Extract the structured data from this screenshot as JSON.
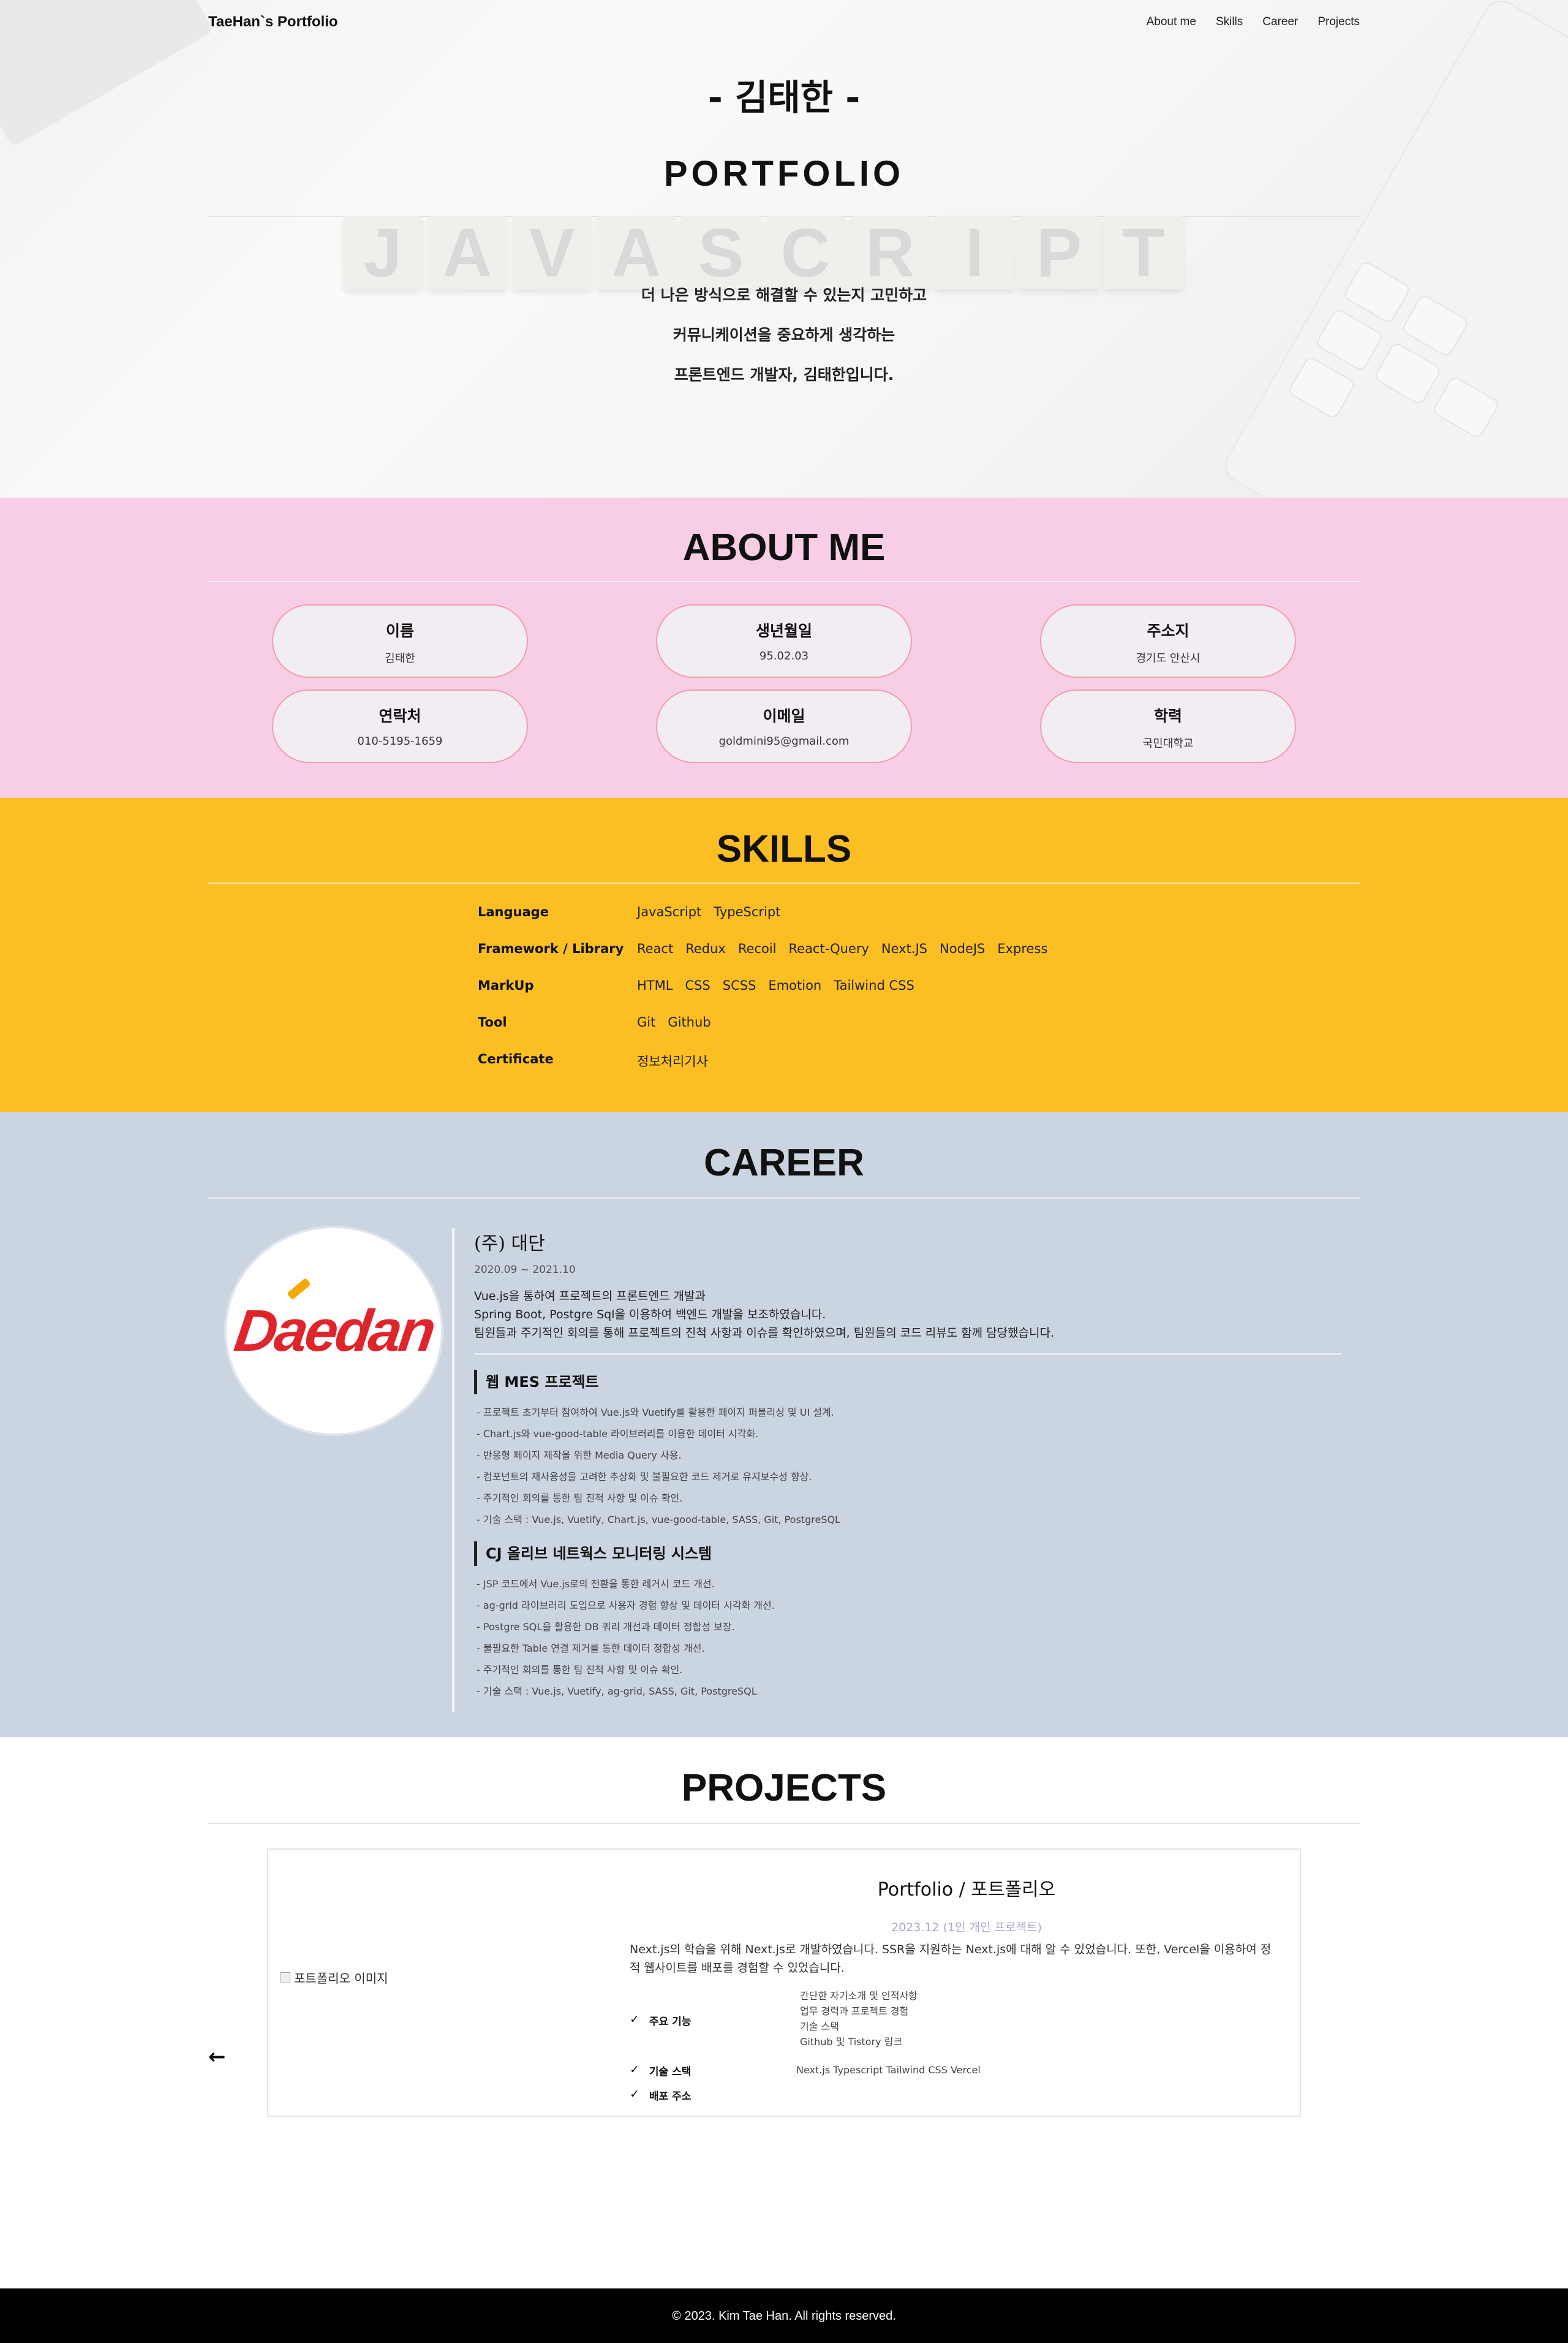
{
  "nav": {
    "brand": "TaeHan`s Portfolio",
    "links": [
      "About me",
      "Skills",
      "Career",
      "Projects"
    ]
  },
  "hero": {
    "name": "- 김태한 -",
    "title": "PORTFOLIO",
    "tiles": [
      "J",
      "A",
      "V",
      "A",
      "S",
      "C",
      "R",
      "I",
      "P",
      "T"
    ],
    "tagline": [
      "더 나은 방식으로 해결할 수 있는지 고민하고",
      "커뮤니케이션을 중요하게 생각하는",
      "프론트엔드 개발자, 김태한입니다."
    ]
  },
  "about": {
    "title": "ABOUT ME",
    "cards": [
      {
        "label": "이름",
        "value": "김태한"
      },
      {
        "label": "생년월일",
        "value": "95.02.03"
      },
      {
        "label": "주소지",
        "value": "경기도 안산시"
      },
      {
        "label": "연락처",
        "value": "010-5195-1659"
      },
      {
        "label": "이메일",
        "value": "goldmini95@gmail.com"
      },
      {
        "label": "학력",
        "value": "국민대학교"
      }
    ]
  },
  "skills": {
    "title": "SKILLS",
    "rows": [
      {
        "category": "Language",
        "items": [
          "JavaScript",
          "TypeScript"
        ]
      },
      {
        "category": "Framework / Library",
        "items": [
          "React",
          "Redux",
          "Recoil",
          "React-Query",
          "Next.JS",
          "NodeJS",
          "Express"
        ]
      },
      {
        "category": "MarkUp",
        "items": [
          "HTML",
          "CSS",
          "SCSS",
          "Emotion",
          "Tailwind CSS"
        ]
      },
      {
        "category": "Tool",
        "items": [
          "Git",
          "Github"
        ]
      },
      {
        "category": "Certificate",
        "items": [
          "정보처리기사"
        ]
      }
    ]
  },
  "career": {
    "title": "CAREER",
    "logo_text": "Daedan",
    "company": "(주) 대단",
    "period": "2020.09 ~ 2021.10",
    "desc": [
      "Vue.js을 통하여 프로젝트의 프론트엔드 개발과",
      "Spring Boot, Postgre Sql을 이용하여 백엔드 개발을 보조하였습니다.",
      "팀원들과 주기적인 회의를 통해 프로젝트의 진척 사항과 이슈를 확인하였으며, 팀원들의 코드 리뷰도 함께 담당했습니다."
    ],
    "projects": [
      {
        "name": "웹 MES 프로젝트",
        "bullets": [
          "- 프로젝트 초기부터 참여하여 Vue.js와 Vuetify를 활용한 페이지 퍼블리싱 및 UI 설계.",
          "- Chart.js와 vue-good-table 라이브러리를 이용한 데이터 시각화.",
          "- 반응형 페이지 제작을 위한 Media Query 사용.",
          "- 컴포넌트의 재사용성을 고려한 추상화 및 불필요한 코드 제거로 유지보수성 향상.",
          "- 주기적인 회의를 통한 팀 진척 사항 및 이슈 확인.",
          "- 기술 스택 : Vue.js, Vuetify, Chart.js, vue-good-table, SASS, Git, PostgreSQL"
        ]
      },
      {
        "name": "CJ 올리브 네트웍스 모니터링 시스템",
        "bullets": [
          "- JSP 코드에서 Vue.js로의 전환을 통한 레거시 코드 개선.",
          "- ag-grid 라이브러리 도입으로 사용자 경험 향상 및 데이터 시각화 개선.",
          "- Postgre SQL을 활용한 DB 쿼리 개선과 데이터 정합성 보장.",
          "- 불필요한 Table 연결 제거를 통한 데이터 정합성 개선.",
          "- 주기적인 회의를 통한 팀 진척 사항 및 이슈 확인.",
          "- 기술 스택 : Vue.js, Vuetify, ag-grid, SASS, Git, PostgreSQL"
        ]
      }
    ]
  },
  "projects": {
    "title": "PROJECTS",
    "image_alt": "포트폴리오 이미지",
    "name": "Portfolio / 포트폴리오",
    "period": "2023.12 (1인 개인 프로젝트)",
    "desc": "Next.js의 학습을 위해 Next.js로 개발하였습니다. SSR을 지원하는 Next.js에 대해 알 수 있었습니다. 또한, Vercel을 이용하여 정적 웹사이트를 배포를 경험할 수 있었습니다.",
    "feature_label": "주요 기능",
    "features": [
      "간단한 자기소개 및 인적사항",
      "업무 경력과 프로젝트 경험",
      "기술 스택",
      "Github 및 Tistory 링크"
    ],
    "stack_label": "기술 스택",
    "stack_value": "Next.js Typescript Tailwind CSS Vercel",
    "deploy_label": "배포 주소",
    "check": "✓",
    "prev_arrow": "←"
  },
  "footer": {
    "text": "© 2023. Kim Tae Han. All rights reserved."
  }
}
